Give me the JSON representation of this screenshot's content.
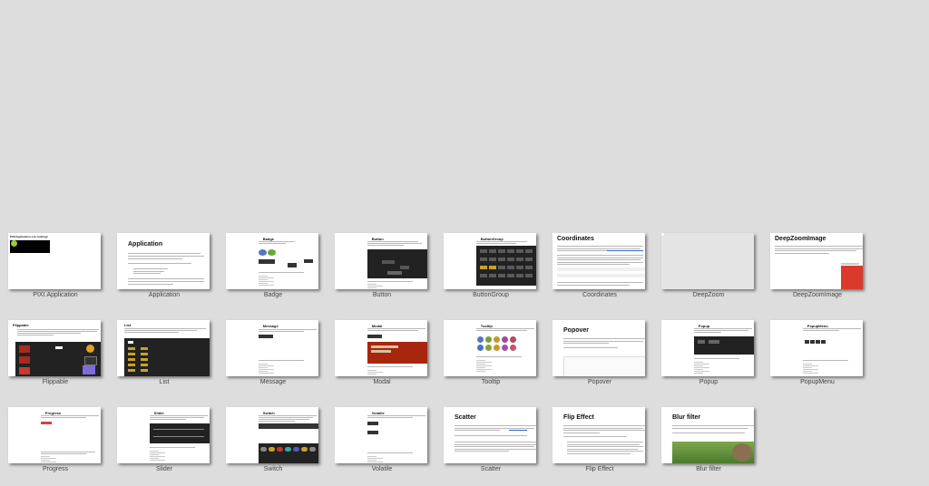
{
  "tiles": [
    {
      "label": "PIXI.Application",
      "heading": "PIXI.Application e1n nothing!",
      "style": "app1"
    },
    {
      "label": "Application",
      "heading": "Application",
      "style": "text-big"
    },
    {
      "label": "Badge",
      "heading": "Badge",
      "style": "badge"
    },
    {
      "label": "Button",
      "heading": "Button",
      "style": "button"
    },
    {
      "label": "ButtonGroup",
      "heading": "ButtonGroup",
      "style": "buttongroup"
    },
    {
      "label": "Coordinates",
      "heading": "Coordinates",
      "style": "coords"
    },
    {
      "label": "DeepZoom",
      "heading": "",
      "style": "deepzoom"
    },
    {
      "label": "DeepZoomImage",
      "heading": "DeepZoomImage",
      "style": "deepzoomimage"
    },
    {
      "label": "Flippable",
      "heading": "Flippable",
      "style": "flippable"
    },
    {
      "label": "List",
      "heading": "List",
      "style": "list"
    },
    {
      "label": "Message",
      "heading": "Message",
      "style": "message"
    },
    {
      "label": "Modal",
      "heading": "Modal",
      "style": "modal"
    },
    {
      "label": "Tooltip",
      "heading": "Tooltip",
      "style": "tooltip"
    },
    {
      "label": "Popover",
      "heading": "Popover",
      "style": "popover"
    },
    {
      "label": "Popup",
      "heading": "Popup",
      "style": "popup"
    },
    {
      "label": "PopupMenu",
      "heading": "PopupMenu",
      "style": "popupmenu"
    },
    {
      "label": "Progress",
      "heading": "Progress",
      "style": "progress"
    },
    {
      "label": "Slider",
      "heading": "Slider",
      "style": "slider"
    },
    {
      "label": "Switch",
      "heading": "Switch",
      "style": "switch"
    },
    {
      "label": "Volatile",
      "heading": "Volatile",
      "style": "volatile"
    },
    {
      "label": "Scatter",
      "heading": "Scatter",
      "style": "scatter"
    },
    {
      "label": "Flip Effect",
      "heading": "Flip Effect",
      "style": "flipeffect"
    },
    {
      "label": "Blur filter",
      "heading": "Blur filter",
      "style": "blur"
    }
  ],
  "colors": {
    "background": "#dddddd",
    "thumb": "#ffffff",
    "dark_canvas": "#222222",
    "modal_red": "#a8250e",
    "deepzoom_red": "#d93a2b",
    "link_blue": "#3366cc"
  }
}
